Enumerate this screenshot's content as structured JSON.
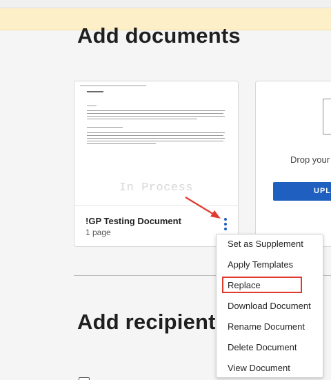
{
  "page": {
    "add_documents_title": "Add documents",
    "add_recipients_title": "Add recipient"
  },
  "document": {
    "name": "!GP Testing Document",
    "pages": "1 page",
    "watermark": "In Process"
  },
  "upload": {
    "drop_text": "Drop your",
    "button_label": "UPL"
  },
  "context_menu": {
    "items": [
      {
        "label": "Set as Supplement"
      },
      {
        "label": "Apply Templates"
      },
      {
        "label": "Replace"
      },
      {
        "label": "Download Document"
      },
      {
        "label": "Rename Document"
      },
      {
        "label": "Delete Document"
      },
      {
        "label": "View Document"
      }
    ],
    "highlighted_item": "Replace"
  },
  "colors": {
    "banner": "#fdf0c8",
    "accent": "#1f5fbf",
    "annotation": "#e03a2e"
  }
}
